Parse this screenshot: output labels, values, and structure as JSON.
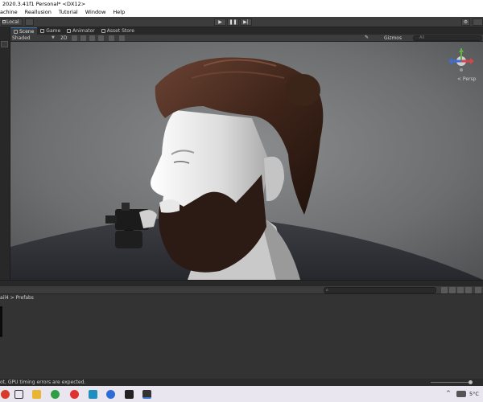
{
  "window": {
    "title": "2020.3.41f1 Personal* <DX12>"
  },
  "menu": [
    "achine",
    "Reallusion",
    "Tutorial",
    "Window",
    "Help"
  ],
  "toolbar": {
    "pivot_label": "Local"
  },
  "tabs": [
    "Scene",
    "Game",
    "Animator",
    "Asset Store"
  ],
  "scene_toolbar": {
    "shading_mode": "Shaded",
    "mode_2d": "2D",
    "gizmos_label": "Gizmos",
    "search_placeholder": "All"
  },
  "view_gizmo": {
    "projection_label": "< Persp"
  },
  "project": {
    "breadcrumb": "ail4 > Prefabs"
  },
  "status": {
    "message": "ot, GPU timing errors are expected."
  },
  "taskbar": {
    "weather": "5°C"
  },
  "colors": {
    "accent": "#3a79bb",
    "panel": "#3c3c3c",
    "viewport_bg": "#6d6e70"
  }
}
